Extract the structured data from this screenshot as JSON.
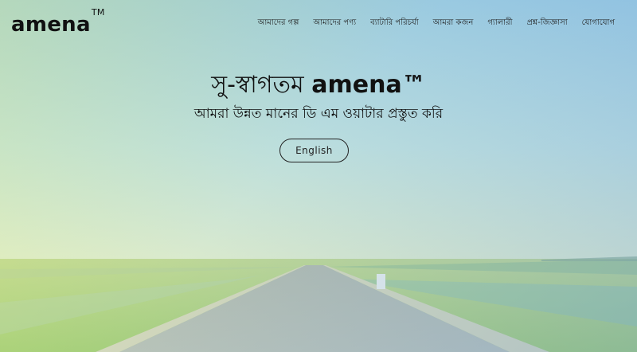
{
  "brand": {
    "name": "amena",
    "mark": "TM"
  },
  "nav": [
    {
      "label": "আমাদের গল্প"
    },
    {
      "label": "আমাদের পণ্য"
    },
    {
      "label": "ব্যাটারি পরিচর্যা"
    },
    {
      "label": "আমরা কজন"
    },
    {
      "label": "গ্যালারী"
    },
    {
      "label": "প্রশ্ন-জিজ্ঞাসা"
    },
    {
      "label": "যোগাযোগ"
    }
  ],
  "hero": {
    "welcome": "সু-স্বাগতম",
    "brand": "amena™",
    "tagline": "আমরা উন্নত মানের ডি এম ওয়াটার প্রস্তুত করি",
    "language_button": "English"
  }
}
